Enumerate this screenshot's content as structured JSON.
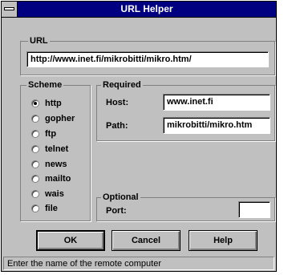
{
  "window": {
    "title": "URL Helper"
  },
  "url": {
    "group_label": "URL",
    "value": "http://www.inet.fi/mikrobitti/mikro.htm/"
  },
  "scheme": {
    "group_label": "Scheme",
    "options": [
      "http",
      "gopher",
      "ftp",
      "telnet",
      "news",
      "mailto",
      "wais",
      "file"
    ],
    "selected": "http"
  },
  "required": {
    "group_label": "Required",
    "host_label": "Host:",
    "host_value": "www.inet.fi",
    "path_label": "Path:",
    "path_value": "mikrobitti/mikro.htm"
  },
  "optional": {
    "group_label": "Optional",
    "port_label": "Port:",
    "port_value": ""
  },
  "buttons": {
    "ok": "OK",
    "cancel": "Cancel",
    "help": "Help"
  },
  "status_text": "Enter the name of the remote computer"
}
